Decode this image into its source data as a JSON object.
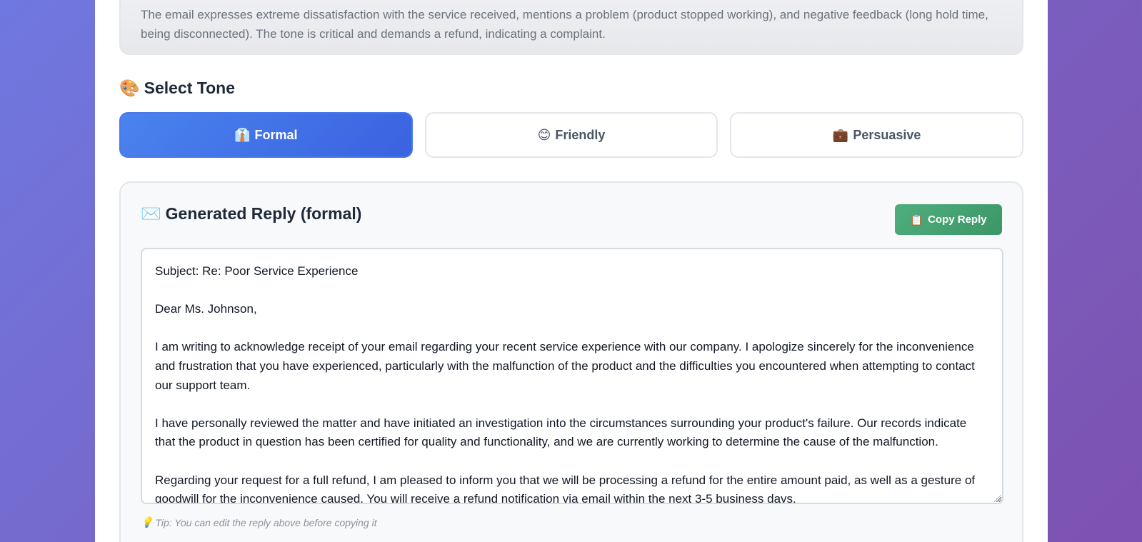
{
  "analysis": {
    "text": "The email expresses extreme dissatisfaction with the service received, mentions a problem (product stopped working), and negative feedback (long hold time, being disconnected). The tone is critical and demands a refund, indicating a complaint."
  },
  "tone_section": {
    "icon": "🎨",
    "title": "Select Tone",
    "options": [
      {
        "icon": "👔",
        "label": "Formal",
        "active": true
      },
      {
        "icon": "😊",
        "label": "Friendly",
        "active": false
      },
      {
        "icon": "💼",
        "label": "Persuasive",
        "active": false
      }
    ]
  },
  "reply": {
    "icon": "✉️",
    "title": "Generated Reply (formal)",
    "copy_icon": "📋",
    "copy_label": "Copy Reply",
    "body": "Subject: Re: Poor Service Experience\n\nDear Ms. Johnson,\n\nI am writing to acknowledge receipt of your email regarding your recent service experience with our company. I apologize sincerely for the inconvenience and frustration that you have experienced, particularly with the malfunction of the product and the difficulties you encountered when attempting to contact our support team.\n\nI have personally reviewed the matter and have initiated an investigation into the circumstances surrounding your product's failure. Our records indicate that the product in question has been certified for quality and functionality, and we are currently working to determine the cause of the malfunction.\n\nRegarding your request for a full refund, I am pleased to inform you that we will be processing a refund for the entire amount paid, as well as a gesture of goodwill for the inconvenience caused. You will receive a refund notification via email within the next 3-5 business days.",
    "tip_icon": "💡",
    "tip": "Tip: You can edit the reply above before copying it"
  },
  "colors": {
    "background_gradient_start": "#6f78e0",
    "background_gradient_end": "#7d52b0",
    "active_tone": "#4a83ee",
    "copy_button": "#4fae7e"
  }
}
